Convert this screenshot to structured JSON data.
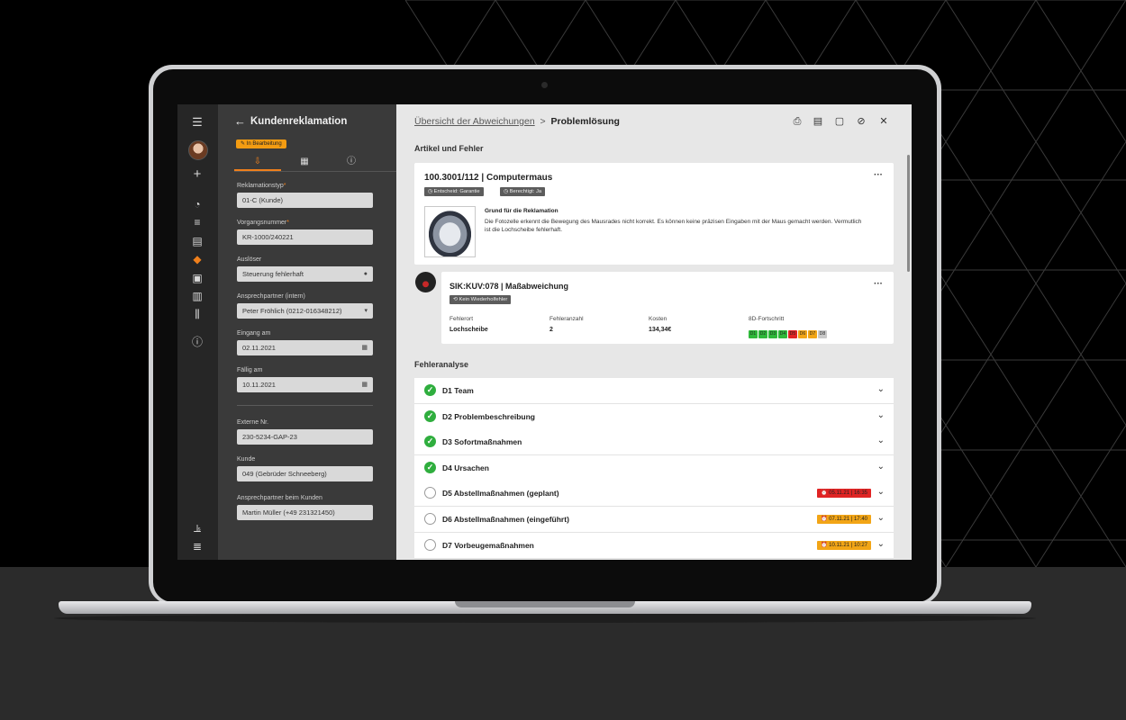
{
  "form_panel": {
    "title": "Kundenreklamation",
    "status": "In Bearbeitung",
    "fields": [
      {
        "label": "Reklamationstyp",
        "required": true,
        "value": "01-C (Kunde)",
        "icon": ""
      },
      {
        "label": "Vorgangsnummer",
        "required": true,
        "value": "KR-1000/240221",
        "icon": ""
      },
      {
        "label": "Auslöser",
        "required": false,
        "value": "Steuerung fehlerhaft",
        "icon": "comment-icon"
      },
      {
        "label": "Ansprechpartner (intern)",
        "required": false,
        "value": "Peter Fröhlich (0212-016348212)",
        "icon": "chevron-down-icon"
      },
      {
        "label": "Eingang am",
        "required": false,
        "value": "02.11.2021",
        "icon": "calendar-icon"
      },
      {
        "label": "Fällig am",
        "required": false,
        "value": "10.11.2021",
        "icon": "calendar-icon"
      },
      {
        "label": "Externe Nr.",
        "required": false,
        "value": "230-5234-GAP-23",
        "icon": ""
      },
      {
        "label": "Kunde",
        "required": false,
        "value": "049 (Gebrüder Schneeberg)",
        "icon": ""
      },
      {
        "label": "Ansprechpartner beim Kunden",
        "required": false,
        "value": "Martin Müller (+49 231321450)",
        "icon": ""
      }
    ]
  },
  "breadcrumb": {
    "parent": "Übersicht der Abweichungen",
    "separator": ">",
    "current": "Problemlösung"
  },
  "sections": {
    "article": "Artikel und Fehler",
    "analysis": "Fehleranalyse"
  },
  "article_card": {
    "title": "100.3001/112 | Computermaus",
    "chips": [
      "Entscheid: Garantie",
      "Berechtigt: Ja"
    ],
    "reason_title": "Grund für die Reklamation",
    "reason_text": "Die Fotozelle erkennt die Bewegung des Mausrades nicht korrekt. Es können keine präzisen Eingaben mit der Maus gemacht werden. Vermutlich ist die Lochscheibe fehlerhaft."
  },
  "defect_card": {
    "title": "SIK:KUV:078 | Maßabweichung",
    "chip": "Kein Wiederholfehler",
    "fehlerort_label": "Fehlerort",
    "fehlerort": "Lochscheibe",
    "anzahl_label": "Fehleranzahl",
    "anzahl": "2",
    "kosten_label": "Kosten",
    "kosten": "134,34€",
    "progress_label": "8D-Fortschritt",
    "progress": [
      {
        "label": "D1",
        "color": "#2fb83a"
      },
      {
        "label": "D2",
        "color": "#2fb83a"
      },
      {
        "label": "D3",
        "color": "#2fb83a"
      },
      {
        "label": "D4",
        "color": "#2fb83a"
      },
      {
        "label": "D5",
        "color": "#e02424"
      },
      {
        "label": "D6",
        "color": "#f2a516"
      },
      {
        "label": "D7",
        "color": "#f2a516"
      },
      {
        "label": "D8",
        "color": "#c9c9c9"
      }
    ]
  },
  "analysis_rows": [
    {
      "label": "D1 Team",
      "done": true,
      "due": ""
    },
    {
      "label": "D2 Problembeschreibung",
      "done": true,
      "due": ""
    },
    {
      "label": "D3 Sofortmaßnahmen",
      "done": true,
      "due": ""
    },
    {
      "label": "D4 Ursachen",
      "done": true,
      "due": ""
    },
    {
      "label": "D5 Abstellmaßnahmen (geplant)",
      "done": false,
      "due": "05.11.21 | 16:35",
      "due_color": "#e02424"
    },
    {
      "label": "D6 Abstellmaßnahmen (eingeführt)",
      "done": false,
      "due": "07.11.21 | 17:40",
      "due_color": "#f2a516"
    },
    {
      "label": "D7 Vorbeugemaßnahmen",
      "done": false,
      "due": "10.11.21 | 10:27",
      "due_color": "#f2a516"
    }
  ],
  "colors": {
    "accent": "#f0801c",
    "panel": "#3a3a3a",
    "rail": "#262626"
  }
}
